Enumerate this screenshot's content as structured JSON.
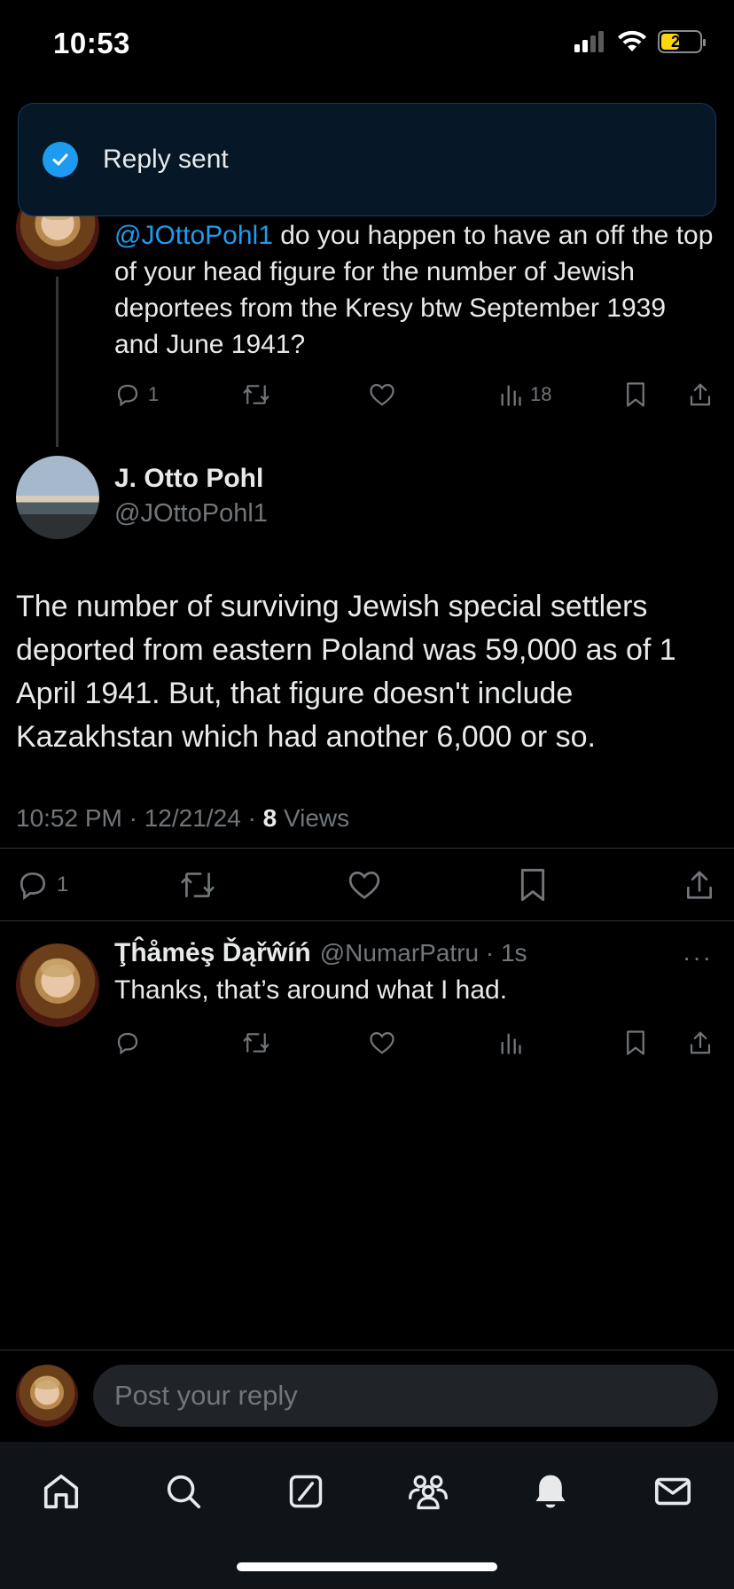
{
  "status_bar": {
    "time": "10:53",
    "battery": "24"
  },
  "toast": {
    "text": "Reply sent"
  },
  "parent_tweet": {
    "mention": "@JOttoPohl1",
    "text": " do you happen to have an off the top of your head figure for the number of Jewish deportees from the Kresy btw September 1939 and June 1941?",
    "reply_count": "1",
    "view_count": "18"
  },
  "main_tweet": {
    "author_name": "J. Otto Pohl",
    "author_handle": "@JOttoPohl1",
    "text": "The number of surviving Jewish special settlers deported from eastern Poland was 59,000 as of 1 April 1941.  But, that figure doesn't include Kazakhstan which had another 6,000 or so.",
    "timestamp": "10:52 PM · 12/21/24 · ",
    "views_count": "8",
    "views_label": " Views",
    "reply_count": "1"
  },
  "reply": {
    "name": "Ţĥåmėş Ďąřŵíń",
    "handle": "@NumarPatru · 1s",
    "more": "···",
    "text": "Thanks, that’s around what I had."
  },
  "composer": {
    "placeholder": "Post your reply"
  },
  "icons": {
    "reply": "reply-icon",
    "repost": "repost-icon",
    "like": "heart-icon",
    "views": "views-icon",
    "bookmark": "bookmark-icon",
    "share": "share-icon"
  },
  "colors": {
    "accent": "#1d9bf0",
    "muted": "#71767b",
    "text": "#e7e9ea",
    "toast_bg": "#061828"
  }
}
